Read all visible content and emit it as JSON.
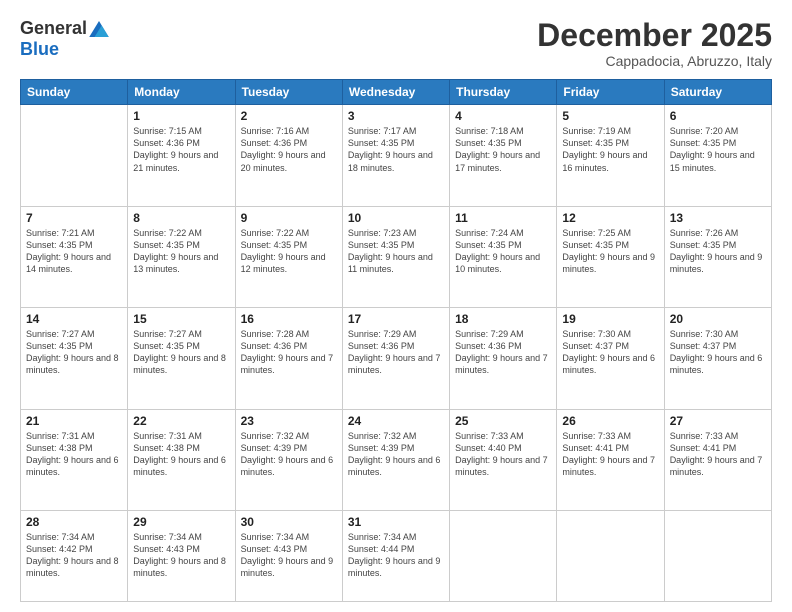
{
  "logo": {
    "general": "General",
    "blue": "Blue"
  },
  "title": "December 2025",
  "location": "Cappadocia, Abruzzo, Italy",
  "days_header": [
    "Sunday",
    "Monday",
    "Tuesday",
    "Wednesday",
    "Thursday",
    "Friday",
    "Saturday"
  ],
  "weeks": [
    [
      {
        "day": "",
        "sunrise": "",
        "sunset": "",
        "daylight": ""
      },
      {
        "day": "1",
        "sunrise": "Sunrise: 7:15 AM",
        "sunset": "Sunset: 4:36 PM",
        "daylight": "Daylight: 9 hours and 21 minutes."
      },
      {
        "day": "2",
        "sunrise": "Sunrise: 7:16 AM",
        "sunset": "Sunset: 4:36 PM",
        "daylight": "Daylight: 9 hours and 20 minutes."
      },
      {
        "day": "3",
        "sunrise": "Sunrise: 7:17 AM",
        "sunset": "Sunset: 4:35 PM",
        "daylight": "Daylight: 9 hours and 18 minutes."
      },
      {
        "day": "4",
        "sunrise": "Sunrise: 7:18 AM",
        "sunset": "Sunset: 4:35 PM",
        "daylight": "Daylight: 9 hours and 17 minutes."
      },
      {
        "day": "5",
        "sunrise": "Sunrise: 7:19 AM",
        "sunset": "Sunset: 4:35 PM",
        "daylight": "Daylight: 9 hours and 16 minutes."
      },
      {
        "day": "6",
        "sunrise": "Sunrise: 7:20 AM",
        "sunset": "Sunset: 4:35 PM",
        "daylight": "Daylight: 9 hours and 15 minutes."
      }
    ],
    [
      {
        "day": "7",
        "sunrise": "Sunrise: 7:21 AM",
        "sunset": "Sunset: 4:35 PM",
        "daylight": "Daylight: 9 hours and 14 minutes."
      },
      {
        "day": "8",
        "sunrise": "Sunrise: 7:22 AM",
        "sunset": "Sunset: 4:35 PM",
        "daylight": "Daylight: 9 hours and 13 minutes."
      },
      {
        "day": "9",
        "sunrise": "Sunrise: 7:22 AM",
        "sunset": "Sunset: 4:35 PM",
        "daylight": "Daylight: 9 hours and 12 minutes."
      },
      {
        "day": "10",
        "sunrise": "Sunrise: 7:23 AM",
        "sunset": "Sunset: 4:35 PM",
        "daylight": "Daylight: 9 hours and 11 minutes."
      },
      {
        "day": "11",
        "sunrise": "Sunrise: 7:24 AM",
        "sunset": "Sunset: 4:35 PM",
        "daylight": "Daylight: 9 hours and 10 minutes."
      },
      {
        "day": "12",
        "sunrise": "Sunrise: 7:25 AM",
        "sunset": "Sunset: 4:35 PM",
        "daylight": "Daylight: 9 hours and 9 minutes."
      },
      {
        "day": "13",
        "sunrise": "Sunrise: 7:26 AM",
        "sunset": "Sunset: 4:35 PM",
        "daylight": "Daylight: 9 hours and 9 minutes."
      }
    ],
    [
      {
        "day": "14",
        "sunrise": "Sunrise: 7:27 AM",
        "sunset": "Sunset: 4:35 PM",
        "daylight": "Daylight: 9 hours and 8 minutes."
      },
      {
        "day": "15",
        "sunrise": "Sunrise: 7:27 AM",
        "sunset": "Sunset: 4:35 PM",
        "daylight": "Daylight: 9 hours and 8 minutes."
      },
      {
        "day": "16",
        "sunrise": "Sunrise: 7:28 AM",
        "sunset": "Sunset: 4:36 PM",
        "daylight": "Daylight: 9 hours and 7 minutes."
      },
      {
        "day": "17",
        "sunrise": "Sunrise: 7:29 AM",
        "sunset": "Sunset: 4:36 PM",
        "daylight": "Daylight: 9 hours and 7 minutes."
      },
      {
        "day": "18",
        "sunrise": "Sunrise: 7:29 AM",
        "sunset": "Sunset: 4:36 PM",
        "daylight": "Daylight: 9 hours and 7 minutes."
      },
      {
        "day": "19",
        "sunrise": "Sunrise: 7:30 AM",
        "sunset": "Sunset: 4:37 PM",
        "daylight": "Daylight: 9 hours and 6 minutes."
      },
      {
        "day": "20",
        "sunrise": "Sunrise: 7:30 AM",
        "sunset": "Sunset: 4:37 PM",
        "daylight": "Daylight: 9 hours and 6 minutes."
      }
    ],
    [
      {
        "day": "21",
        "sunrise": "Sunrise: 7:31 AM",
        "sunset": "Sunset: 4:38 PM",
        "daylight": "Daylight: 9 hours and 6 minutes."
      },
      {
        "day": "22",
        "sunrise": "Sunrise: 7:31 AM",
        "sunset": "Sunset: 4:38 PM",
        "daylight": "Daylight: 9 hours and 6 minutes."
      },
      {
        "day": "23",
        "sunrise": "Sunrise: 7:32 AM",
        "sunset": "Sunset: 4:39 PM",
        "daylight": "Daylight: 9 hours and 6 minutes."
      },
      {
        "day": "24",
        "sunrise": "Sunrise: 7:32 AM",
        "sunset": "Sunset: 4:39 PM",
        "daylight": "Daylight: 9 hours and 6 minutes."
      },
      {
        "day": "25",
        "sunrise": "Sunrise: 7:33 AM",
        "sunset": "Sunset: 4:40 PM",
        "daylight": "Daylight: 9 hours and 7 minutes."
      },
      {
        "day": "26",
        "sunrise": "Sunrise: 7:33 AM",
        "sunset": "Sunset: 4:41 PM",
        "daylight": "Daylight: 9 hours and 7 minutes."
      },
      {
        "day": "27",
        "sunrise": "Sunrise: 7:33 AM",
        "sunset": "Sunset: 4:41 PM",
        "daylight": "Daylight: 9 hours and 7 minutes."
      }
    ],
    [
      {
        "day": "28",
        "sunrise": "Sunrise: 7:34 AM",
        "sunset": "Sunset: 4:42 PM",
        "daylight": "Daylight: 9 hours and 8 minutes."
      },
      {
        "day": "29",
        "sunrise": "Sunrise: 7:34 AM",
        "sunset": "Sunset: 4:43 PM",
        "daylight": "Daylight: 9 hours and 8 minutes."
      },
      {
        "day": "30",
        "sunrise": "Sunrise: 7:34 AM",
        "sunset": "Sunset: 4:43 PM",
        "daylight": "Daylight: 9 hours and 9 minutes."
      },
      {
        "day": "31",
        "sunrise": "Sunrise: 7:34 AM",
        "sunset": "Sunset: 4:44 PM",
        "daylight": "Daylight: 9 hours and 9 minutes."
      },
      {
        "day": "",
        "sunrise": "",
        "sunset": "",
        "daylight": ""
      },
      {
        "day": "",
        "sunrise": "",
        "sunset": "",
        "daylight": ""
      },
      {
        "day": "",
        "sunrise": "",
        "sunset": "",
        "daylight": ""
      }
    ]
  ]
}
